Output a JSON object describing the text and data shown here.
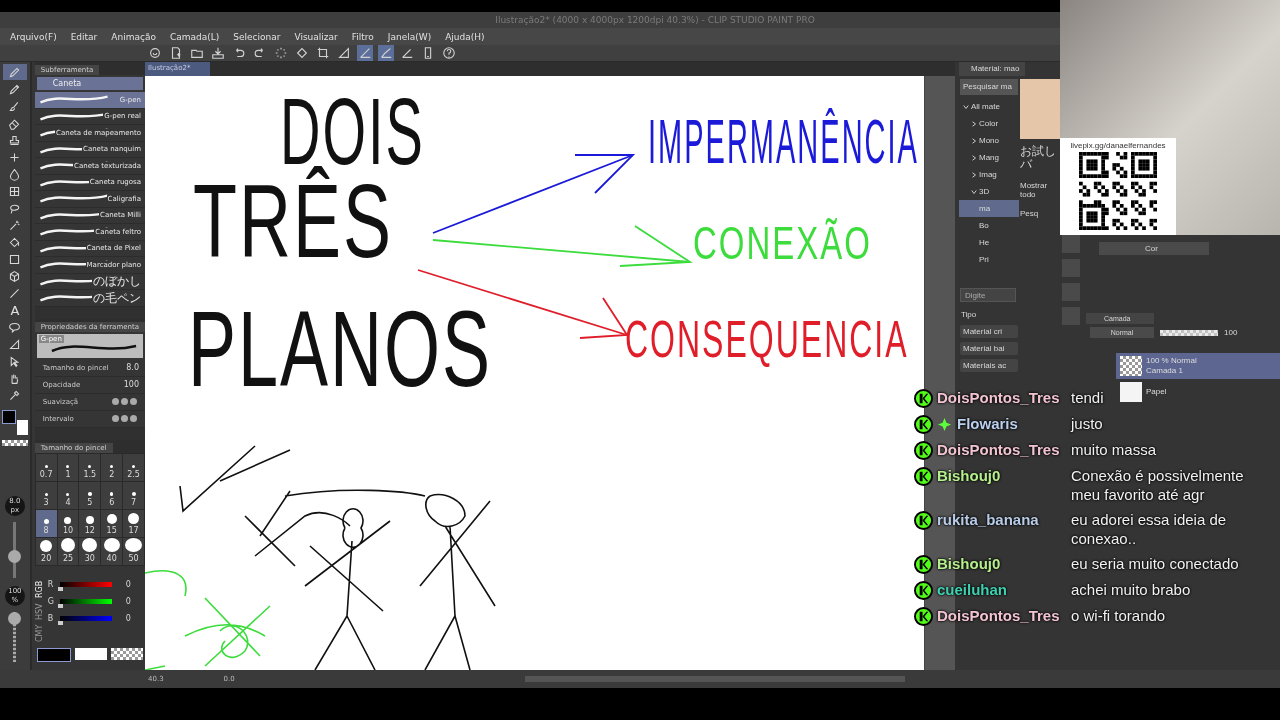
{
  "window": {
    "title": "Ilustração2* (4000 x 4000px 1200dpi 40.3%) - CLIP STUDIO PAINT PRO"
  },
  "menu": [
    "Arquivo(F)",
    "Editar",
    "Animação",
    "Camada(L)",
    "Selecionar",
    "Visualizar",
    "Filtro",
    "Janela(W)",
    "Ajuda(H)"
  ],
  "document_tab": {
    "label": "Ilustração2*"
  },
  "tools": [
    {
      "kind": "pen",
      "selected": true
    },
    {
      "kind": "pencil",
      "selected": false
    },
    {
      "kind": "brush",
      "selected": false
    },
    {
      "kind": "eraser",
      "selected": false
    },
    {
      "kind": "stamp",
      "selected": false
    },
    {
      "kind": "plus",
      "selected": false
    },
    {
      "kind": "fill",
      "selected": false
    },
    {
      "kind": "grid",
      "selected": false
    },
    {
      "kind": "lasso",
      "selected": false
    },
    {
      "kind": "wand",
      "selected": false
    },
    {
      "kind": "bucket",
      "selected": false
    },
    {
      "kind": "gradient",
      "selected": false
    },
    {
      "kind": "cube",
      "selected": false
    },
    {
      "kind": "line",
      "selected": false
    },
    {
      "kind": "text",
      "glyph": "A",
      "selected": false
    },
    {
      "kind": "balloon",
      "selected": false
    },
    {
      "kind": "ruler",
      "selected": false
    },
    {
      "kind": "selector",
      "selected": false
    },
    {
      "kind": "hand",
      "selected": false
    },
    {
      "kind": "eyedropper",
      "selected": false
    }
  ],
  "size_slider": {
    "value": "8.0",
    "unit": "px",
    "level": 0.35
  },
  "opacity_slider": {
    "value": "100",
    "unit": "%",
    "level": 1
  },
  "subtool_panel": {
    "tab": "Subferramenta",
    "group": "Caneta",
    "brushes": [
      {
        "name": "G-pen",
        "selected": true
      },
      {
        "name": "G-pen real",
        "selected": false
      },
      {
        "name": "Caneta de mapeamento",
        "selected": false
      },
      {
        "name": "Caneta nanquim",
        "selected": false
      },
      {
        "name": "Caneta texturizada",
        "selected": false
      },
      {
        "name": "Caneta rugosa",
        "selected": false
      },
      {
        "name": "Caligrafia",
        "selected": false
      },
      {
        "name": "Caneta Milli",
        "selected": false
      },
      {
        "name": "Caneta feltro",
        "selected": false
      },
      {
        "name": "Caneta de Pixel",
        "selected": false
      },
      {
        "name": "Marcador plano",
        "selected": false
      },
      {
        "name": "のぼかし",
        "selected": false
      },
      {
        "name": "の毛ペン",
        "selected": false
      }
    ]
  },
  "tool_property": {
    "title": "Propriedades da ferramenta",
    "preview": "G-pen",
    "rows": [
      {
        "kind": "number",
        "label": "Tamanho do pincel",
        "value": "8.0"
      },
      {
        "kind": "number",
        "label": "Opacidade",
        "value": "100"
      },
      {
        "kind": "dots",
        "label": "Suavizaçã"
      },
      {
        "kind": "dots",
        "label": "Intervalo"
      }
    ]
  },
  "brush_size_panel": {
    "title": "Tamanho do pincel",
    "sizes": [
      {
        "label": "0.7",
        "selected": false
      },
      {
        "label": "1",
        "selected": false
      },
      {
        "label": "1.5",
        "selected": false
      },
      {
        "label": "2",
        "selected": false
      },
      {
        "label": "2.5",
        "selected": false
      },
      {
        "label": "3",
        "selected": false
      },
      {
        "label": "4",
        "selected": false
      },
      {
        "label": "5",
        "selected": false
      },
      {
        "label": "6",
        "selected": false
      },
      {
        "label": "7",
        "selected": false
      },
      {
        "label": "8",
        "selected": true
      },
      {
        "label": "10",
        "selected": false
      },
      {
        "label": "12",
        "selected": false
      },
      {
        "label": "15",
        "selected": false
      },
      {
        "label": "17",
        "selected": false
      },
      {
        "label": "20",
        "selected": false
      },
      {
        "label": "25",
        "selected": false
      },
      {
        "label": "30",
        "selected": false
      },
      {
        "label": "40",
        "selected": false
      },
      {
        "label": "50",
        "selected": false
      }
    ]
  },
  "color_sliders": {
    "modes": [
      {
        "label": "RGB",
        "selected": true
      },
      {
        "label": "HSV",
        "selected": false
      },
      {
        "label": "CMY",
        "selected": false
      }
    ],
    "channels": [
      {
        "name": "R",
        "value": "0",
        "level": 0
      },
      {
        "name": "G",
        "value": "0",
        "level": 0
      },
      {
        "name": "B",
        "value": "0",
        "level": 0
      }
    ]
  },
  "canvas": {
    "words": [
      {
        "text": "DOIS",
        "color": "#111111"
      },
      {
        "text": "TRÊS",
        "color": "#111111"
      },
      {
        "text": "PLANOS",
        "color": "#111111"
      },
      {
        "text": "IMPERMANÊNCIA",
        "color": "#1a1ad8"
      },
      {
        "text": "CONEXÃO",
        "color": "#3cdc3c"
      },
      {
        "text": "CONSEQUENCIA",
        "color": "#e01e2a"
      }
    ]
  },
  "status_bar": {
    "zoom": "40.3",
    "angle": "0.0"
  },
  "material_panel": {
    "tab": "Material: mao",
    "search": "Pesquisar ma",
    "tree": [
      {
        "label": "All mate",
        "expanded": true,
        "selected": false,
        "children": [
          {
            "label": "Color",
            "expanded": false,
            "selected": false
          },
          {
            "label": "Mono",
            "expanded": false,
            "selected": false
          },
          {
            "label": "Mang",
            "expanded": false,
            "selected": false
          },
          {
            "label": "Imag",
            "expanded": false,
            "selected": false
          },
          {
            "label": "3D",
            "expanded": true,
            "selected": false,
            "children": [
              {
                "label": "ma",
                "selected": true
              },
              {
                "label": "Bo",
                "selected": false
              },
              {
                "label": "He",
                "selected": false
              },
              {
                "label": "Pri",
                "selected": false
              }
            ]
          }
        ]
      }
    ],
    "caption": "お試しバ",
    "show_all": "Mostrar todo",
    "search_button": "Pesq"
  },
  "tag_panel": {
    "placeholder": "Digite",
    "type_label": "Tipo",
    "types": [
      "Material cri",
      "Material bai",
      "Materiais ac"
    ]
  },
  "color_panel": {
    "dropdown": "Cor"
  },
  "layer_panel": {
    "tab": "Camada",
    "blend": "Normal",
    "opacity": {
      "value": "100",
      "level": 1
    },
    "layers": [
      {
        "kind": "raster",
        "mode": "100 % Normal",
        "name": "Camada 1",
        "selected": true
      },
      {
        "kind": "paper",
        "name": "Papel",
        "selected": false
      }
    ]
  },
  "qr": {
    "url": "livepix.gg/danaelfernandes"
  },
  "chat": [
    {
      "user": "DoisPontos_Tres",
      "color": "#f2c4d2",
      "sparkle": false,
      "message": "tendi"
    },
    {
      "user": "Flowaris",
      "color": "#bcd0f0",
      "sparkle": true,
      "message": "justo"
    },
    {
      "user": "DoisPontos_Tres",
      "color": "#f2c4d2",
      "sparkle": false,
      "message": "muito massa"
    },
    {
      "user": "Bishouj0",
      "color": "#b6f08c",
      "sparkle": false,
      "message": "Conexão é possivelmente meu favorito até agr"
    },
    {
      "user": "rukita_banana",
      "color": "#b8cce8",
      "sparkle": false,
      "message": "eu adorei essa ideia de conexao.."
    },
    {
      "user": "Bishouj0",
      "color": "#b6f08c",
      "sparkle": false,
      "message": "eu seria muito conectado"
    },
    {
      "user": "cueiluhan",
      "color": "#3ed2b0",
      "sparkle": false,
      "message": "achei muito brabo"
    },
    {
      "user": "DoisPontos_Tres",
      "color": "#f2c4d2",
      "sparkle": false,
      "message": "o wi-fi torando"
    }
  ]
}
